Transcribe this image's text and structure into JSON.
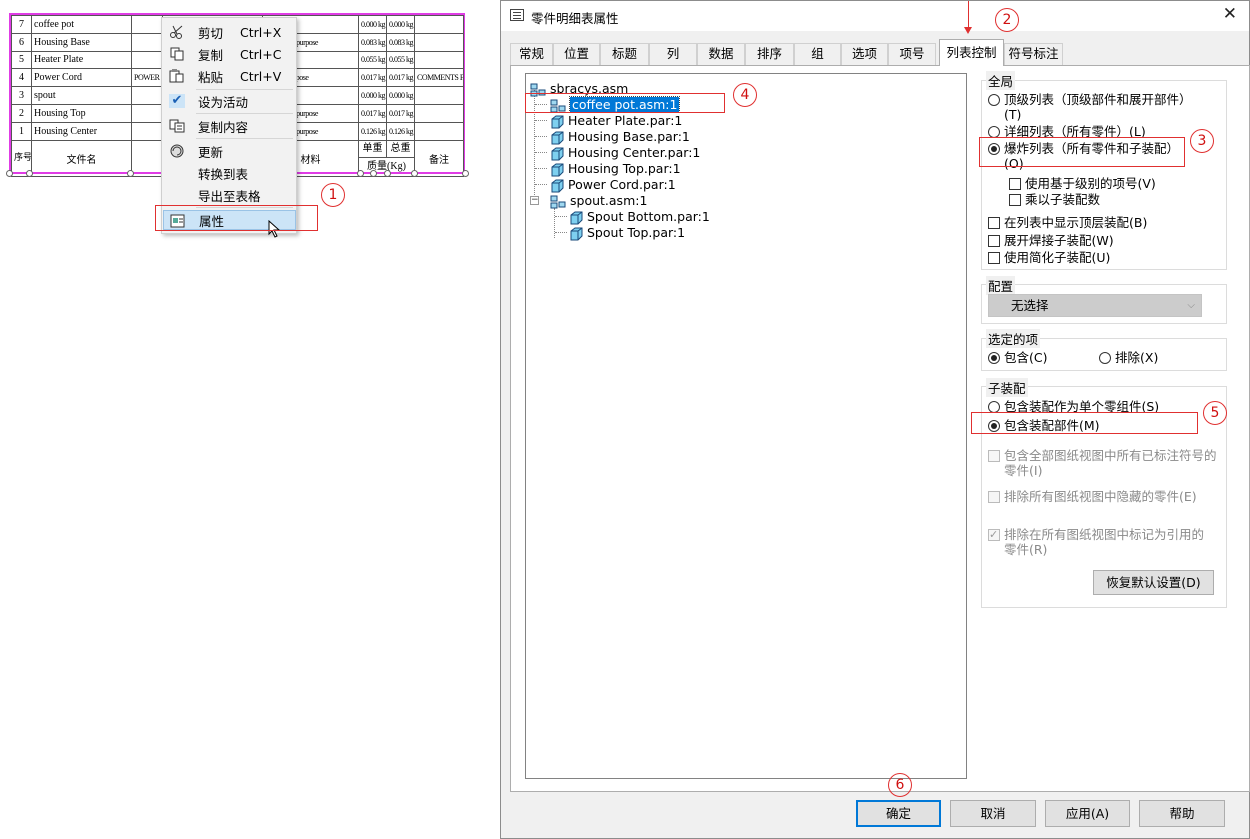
{
  "parts_table": {
    "rows": [
      {
        "no": "7",
        "name": "coffee pot",
        "mid": "",
        "material": "",
        "unit_mass": "0.000 kg",
        "total_mass": "0.000 kg",
        "note": ""
      },
      {
        "no": "6",
        "name": "Housing Base",
        "mid": "",
        "material": "ne, general purpose",
        "unit_mass": "0.083 kg",
        "total_mass": "0.083 kg",
        "note": ""
      },
      {
        "no": "5",
        "name": "Heater Plate",
        "mid": "",
        "material": "",
        "unit_mass": "0.055 kg",
        "total_mass": "0.055 kg",
        "note": ""
      },
      {
        "no": "4",
        "name": "Power Cord",
        "mid": "POWER C",
        "material": "general purpose",
        "unit_mass": "0.017 kg",
        "total_mass": "0.017 kg",
        "note": "COMMENTS FIELD"
      },
      {
        "no": "3",
        "name": "spout",
        "mid": "",
        "material": "",
        "unit_mass": "0.000 kg",
        "total_mass": "0.000 kg",
        "note": ""
      },
      {
        "no": "2",
        "name": "Housing Top",
        "mid": "",
        "material": "ne, general purpose",
        "unit_mass": "0.017 kg",
        "total_mass": "0.017 kg",
        "note": ""
      },
      {
        "no": "1",
        "name": "Housing Center",
        "mid": "",
        "material": "ne, general purpose",
        "unit_mass": "0.126 kg",
        "total_mass": "0.126 kg",
        "note": ""
      }
    ],
    "header": {
      "no": "序号",
      "name": "文件名",
      "material": "材料",
      "unit": "单重",
      "total": "总重",
      "mass": "质量(Kg)",
      "note": "备注"
    }
  },
  "context_menu": {
    "items": [
      {
        "label": "剪切",
        "shortcut": "Ctrl+X",
        "icon": "scissors-icon"
      },
      {
        "label": "复制",
        "shortcut": "Ctrl+C",
        "icon": "copy-icon"
      },
      {
        "label": "粘贴",
        "shortcut": "Ctrl+V",
        "icon": "paste-icon"
      },
      {
        "label": "设为活动",
        "shortcut": "",
        "icon": "checkmark-icon"
      },
      {
        "label": "复制内容",
        "shortcut": "",
        "icon": "copy-content-icon"
      },
      {
        "label": "更新",
        "shortcut": "",
        "icon": "update-icon"
      },
      {
        "label": "转换到表",
        "shortcut": "",
        "icon": ""
      },
      {
        "label": "导出至表格",
        "shortcut": "",
        "icon": ""
      },
      {
        "label": "属性",
        "shortcut": "",
        "icon": "properties-icon"
      }
    ]
  },
  "callouts": {
    "c1": "1",
    "c2": "2",
    "c3": "3",
    "c4": "4",
    "c5": "5",
    "c6": "6"
  },
  "dialog": {
    "title": "零件明细表属性",
    "close": "✕",
    "tabs": [
      "常规",
      "位置",
      "标题",
      "列",
      "数据",
      "排序",
      "组",
      "选项",
      "项号",
      "列表控制",
      "符号标注"
    ],
    "tree": {
      "root": "sbracys.asm",
      "selected": "coffee pot.asm:1",
      "items": [
        "Heater Plate.par:1",
        "Housing Base.par:1",
        "Housing Center.par:1",
        "Housing Top.par:1",
        "Power Cord.par:1"
      ],
      "sub": "spout.asm:1",
      "sub_items": [
        "Spout Bottom.par:1",
        "Spout Top.par:1"
      ]
    },
    "global": {
      "title": "全局",
      "top_list": "顶级列表（顶级部件和展开部件）",
      "top_list_key": "(T)",
      "detail_list": "详细列表（所有零件）(L)",
      "exploded_list": "爆炸列表（所有零件和子装配）",
      "exploded_key": "(O)",
      "level_item": "使用基于级别的项号(V)",
      "multiply": "乘以子装配数",
      "show_top": "在列表中显示顶层装配(B)",
      "expand_weld": "展开焊接子装配(W)",
      "simplified": "使用简化子装配(U)"
    },
    "config": {
      "title": "配置",
      "value": "无选择"
    },
    "selected_items": {
      "title": "选定的项",
      "include": "包含(C)",
      "exclude": "排除(X)"
    },
    "subassembly": {
      "title": "子装配",
      "as_single": "包含装配作为单个零组件(S)",
      "as_parts": "包含装配部件(M)",
      "opt1a": "包含全部图纸视图中所有已标注符号的",
      "opt1b": "零件(I)",
      "opt2": "排除所有图纸视图中隐藏的零件(E)",
      "opt3a": "排除在所有图纸视图中标记为引用的",
      "opt3b": "零件(R)",
      "restore": "恢复默认设置(D)"
    },
    "buttons": {
      "ok": "确定",
      "cancel": "取消",
      "apply": "应用(A)",
      "help": "帮助"
    }
  }
}
